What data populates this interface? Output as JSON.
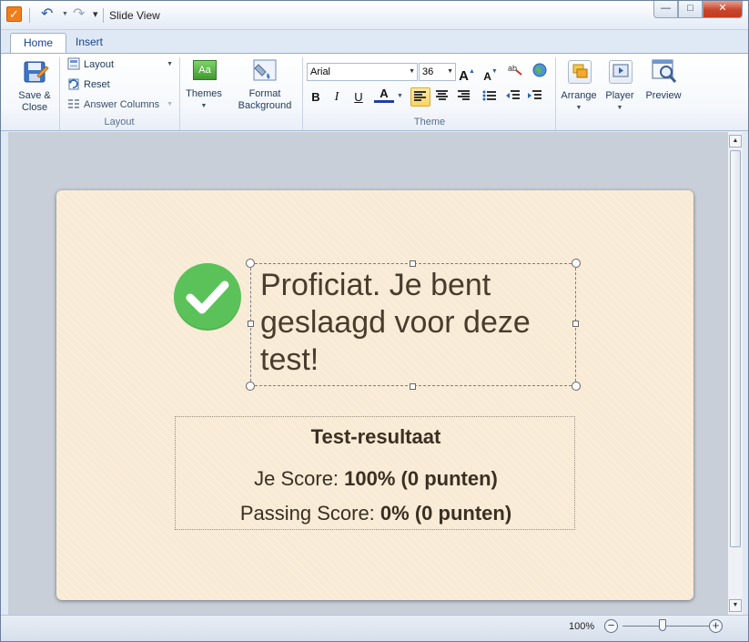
{
  "window": {
    "title": "Slide View",
    "controls": {
      "minimize": "—",
      "maximize": "□",
      "close": "✕"
    }
  },
  "quick_access": {
    "undo": "↶",
    "redo": "↷",
    "customize": "▾"
  },
  "tabs": [
    {
      "label": "Home",
      "active": true
    },
    {
      "label": "Insert",
      "active": false
    }
  ],
  "ribbon": {
    "save_close": {
      "line1": "Save &",
      "line2": "Close"
    },
    "layout_group": {
      "label": "Layout",
      "layout": "Layout",
      "reset": "Reset",
      "answer_columns": "Answer Columns"
    },
    "theme_group": {
      "label": "Theme",
      "themes": "Themes",
      "themes_icon_text": "Aa",
      "format_background": {
        "line1": "Format",
        "line2": "Background"
      },
      "font": "Arial",
      "font_size": "36",
      "bold": "B",
      "italic": "I",
      "underline": "U",
      "font_color": "A"
    },
    "arrange": "Arrange",
    "player": "Player",
    "preview": "Preview"
  },
  "slide": {
    "success_message": "Proficiat. Je bent geslaagd voor deze test!",
    "results": {
      "title": "Test-resultaat",
      "score_label": "Je Score:",
      "score_value": "100% (0 punten)",
      "passing_label": "Passing Score:",
      "passing_value": "0% (0 punten)"
    }
  },
  "status": {
    "zoom": "100%",
    "zoom_level_percent": 100,
    "zoom_out": "−",
    "zoom_in": "+"
  },
  "colors": {
    "accent_orange": "#f07e1b",
    "check_green": "#5bc25a",
    "slide_bg": "#f8ead4",
    "ribbon_text": "#1e395b"
  }
}
